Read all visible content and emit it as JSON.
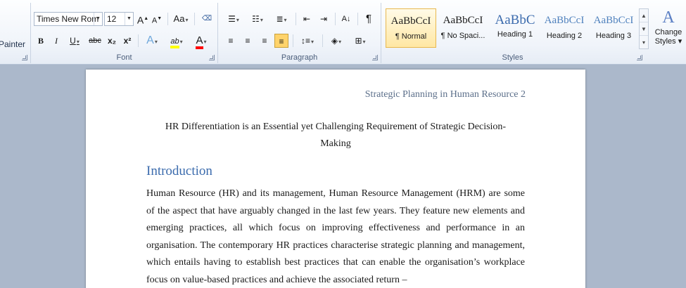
{
  "ribbon": {
    "clipboard": {
      "painter_label": "Painter"
    },
    "font": {
      "group_label": "Font",
      "font_name": "Times New Rom",
      "font_size": "12",
      "grow_glyph": "A",
      "shrink_glyph": "A",
      "change_case": "Aa",
      "bold": "B",
      "italic": "I",
      "underline": "U",
      "strikethrough": "abc",
      "subscript": "x₂",
      "superscript": "x²",
      "text_effects": "A",
      "highlight": "ab",
      "font_color": "A",
      "highlight_color": "#ffff00",
      "font_color_value": "#ff0000"
    },
    "paragraph": {
      "group_label": "Paragraph",
      "show_marks": "¶"
    },
    "styles": {
      "group_label": "Styles",
      "items": [
        {
          "sample": "AaBbCcI",
          "name": "¶ Normal"
        },
        {
          "sample": "AaBbCcI",
          "name": "¶ No Spaci..."
        },
        {
          "sample": "AaBbC",
          "name": "Heading 1"
        },
        {
          "sample": "AaBbCcI",
          "name": "Heading 2"
        },
        {
          "sample": "AaBbCcI",
          "name": "Heading 3"
        }
      ],
      "change_styles_line1": "Change",
      "change_styles_line2": "Styles"
    }
  },
  "document": {
    "header": "Strategic Planning in Human Resource  2",
    "title_line1": "HR Differentiation is an Essential yet Challenging Requirement of Strategic Decision-",
    "title_line2": "Making",
    "heading": "Introduction",
    "body": "Human Resource (HR) and its management, Human Resource Management (HRM) are some of the aspect that have arguably changed in the last few years. They feature new elements and emerging practices, all which focus on improving effectiveness and performance in an organisation. The contemporary HR practices characterise strategic planning and management, which entails having to establish best practices that can enable the organisation’s workplace focus on value-based practices and achieve the associated return –"
  },
  "colors": {
    "accent": "#3b6bad",
    "selected_style": "#ffe7a3",
    "workspace": "#abb8cb"
  }
}
